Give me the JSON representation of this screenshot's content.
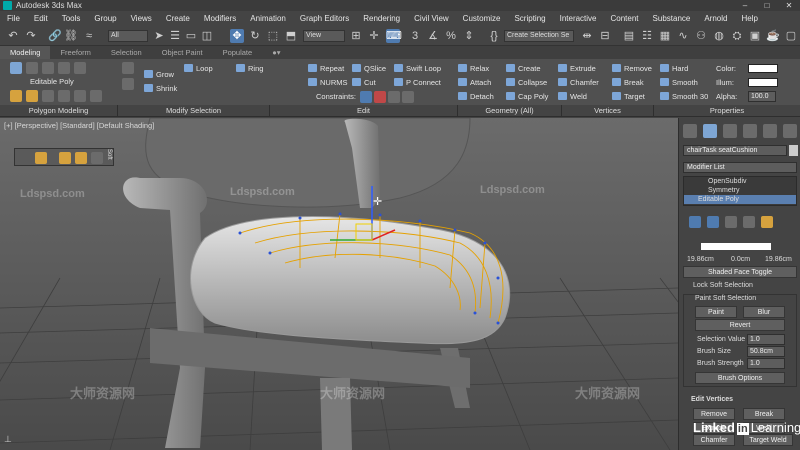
{
  "app": {
    "title": "Autodesk 3ds Max"
  },
  "menu": [
    "File",
    "Edit",
    "Tools",
    "Group",
    "Views",
    "Create",
    "Modifiers",
    "Animation",
    "Graph Editors",
    "Rendering",
    "Civil View",
    "Customize",
    "Scripting",
    "Interactive",
    "Content",
    "Substance",
    "Arnold",
    "Help"
  ],
  "toolbar": {
    "filter": "All",
    "refcoord": "View",
    "selection_set": "Create Selection Se"
  },
  "ribbon_tabs": [
    "Modeling",
    "Freeform",
    "Selection",
    "Object Paint",
    "Populate"
  ],
  "ribbon": {
    "editable_poly": "Editable Poly",
    "grow": "Grow",
    "shrink": "Shrink",
    "loop": "Loop",
    "ring": "Ring",
    "repeat": "Repeat",
    "qslice": "QSlice",
    "swift_loop": "Swift Loop",
    "nurms": "NURMS",
    "cut": "Cut",
    "p_connect": "P Connect",
    "constraints": "Constraints:",
    "relax": "Relax",
    "create": "Create",
    "attach": "Attach",
    "collapse": "Collapse",
    "detach": "Detach",
    "cap_poly": "Cap Poly",
    "extrude": "Extrude",
    "remove": "Remove",
    "chamfer": "Chamfer",
    "break": "Break",
    "weld": "Weld",
    "target": "Target",
    "hard": "Hard",
    "smooth": "Smooth",
    "smooth30": "Smooth 30",
    "color": "Color:",
    "illum": "Illum:",
    "alpha": "Alpha:",
    "alpha_val": "100.0",
    "sections": [
      "Polygon Modeling",
      "Modify Selection",
      "Edit",
      "Geometry (All)",
      "Vertices",
      "Properties"
    ]
  },
  "viewport": {
    "label": "[+] [Perspective] [Standard] [Default Shading]",
    "soft": "Soft"
  },
  "watermarks": [
    "Ldspsd.com",
    "Ldspsd.com",
    "Ldspsd.com",
    "大师资源网",
    "大师资源网",
    "大师资源网"
  ],
  "panel": {
    "object_name": "chairTask seatCushion",
    "modifier_list": "Modifier List",
    "stack": [
      "OpenSubdiv",
      "Symmetry",
      "Editable Poly"
    ],
    "v1": "19.86cm",
    "v2": "0.0cm",
    "v3": "19.86cm",
    "shaded_face": "Shaded Face Toggle",
    "lock_soft": "Lock Soft Selection",
    "paint_soft": "Paint Soft Selection",
    "paint": "Paint",
    "blur": "Blur",
    "revert": "Revert",
    "sel_value_label": "Selection Value",
    "sel_value": "1.0",
    "brush_size_label": "Brush Size",
    "brush_size": "50.8cm",
    "brush_strength_label": "Brush Strength",
    "brush_strength": "1.0",
    "brush_options": "Brush Options",
    "edit_vertices": "Edit Vertices",
    "remove": "Remove",
    "break": "Break",
    "extrude": "Extrude",
    "weld": "Weld",
    "chamfer": "Chamfer",
    "target_weld": "Target Weld"
  },
  "linkedin": "Linked",
  "linkedin2": "in",
  "learning": "Learning"
}
